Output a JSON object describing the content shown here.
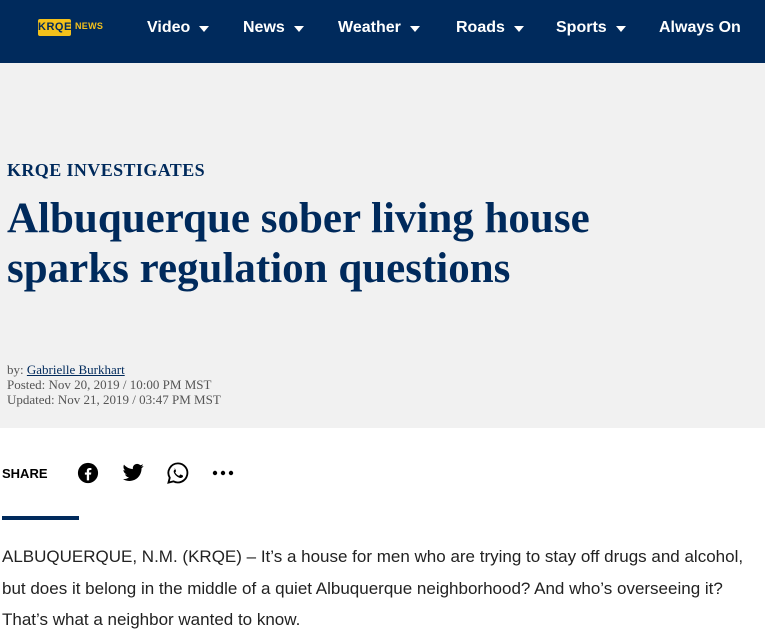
{
  "site": {
    "logo_text": "KRQE",
    "logo_sub": "NEWS",
    "colors": {
      "navy": "#002a5c",
      "gold": "#f4c11b",
      "band": "#f1f1f1"
    }
  },
  "nav": {
    "items": [
      {
        "label": "Video",
        "has_dropdown": true
      },
      {
        "label": "News",
        "has_dropdown": true
      },
      {
        "label": "Weather",
        "has_dropdown": true
      },
      {
        "label": "Roads",
        "has_dropdown": true
      },
      {
        "label": "Sports",
        "has_dropdown": true
      },
      {
        "label": "Always On",
        "has_dropdown": false
      }
    ]
  },
  "article": {
    "section": "KRQE INVESTIGATES",
    "headline": "Albuquerque sober living house sparks regulation questions",
    "byline_prefix": "by:",
    "author": "Gabrielle Burkhart",
    "posted_label": "Posted:",
    "posted": "Nov 20, 2019 / 10:00 PM MST",
    "updated_label": "Updated:",
    "updated": "Nov 21, 2019 / 03:47 PM MST",
    "body": "ALBUQUERQUE, N.M. (KRQE) – It’s a house for men who are trying to stay off drugs and alcohol, but does it belong in the middle of a quiet Albuquerque neighborhood? And who’s overseeing it? That’s what a neighbor wanted to know."
  },
  "share": {
    "label": "SHARE",
    "buttons": [
      "facebook-icon",
      "twitter-icon",
      "whatsapp-icon",
      "more-icon"
    ]
  }
}
